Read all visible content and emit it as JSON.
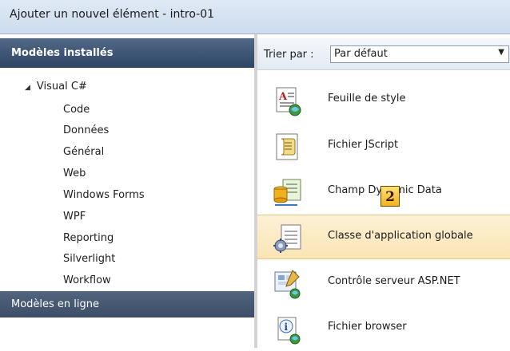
{
  "window": {
    "title": "Ajouter un nouvel élément - intro-01"
  },
  "left_panel": {
    "header": "Modèles installés",
    "tree_root": "Visual C#",
    "items": [
      "Code",
      "Données",
      "Général",
      "Web",
      "Windows Forms",
      "WPF",
      "Reporting",
      "Silverlight",
      "Workflow"
    ],
    "footer": "Modèles en ligne"
  },
  "sort": {
    "label": "Trier par :",
    "value": "Par défaut"
  },
  "templates": [
    {
      "name": "Feuille de style",
      "icon": "stylesheet-icon"
    },
    {
      "name": "Fichier JScript",
      "icon": "jscript-file-icon"
    },
    {
      "name": "Champ Dynamic Data",
      "icon": "dynamic-data-icon"
    },
    {
      "name": "Classe d'application globale",
      "icon": "global-app-class-icon",
      "selected": true
    },
    {
      "name": "Contrôle serveur ASP.NET",
      "icon": "server-control-icon"
    },
    {
      "name": "Fichier browser",
      "icon": "browser-file-icon"
    }
  ],
  "badge": {
    "label": "2"
  },
  "colors": {
    "selection": "#fae4b4",
    "header": "#2e4565",
    "accent": "#f4b21c"
  }
}
